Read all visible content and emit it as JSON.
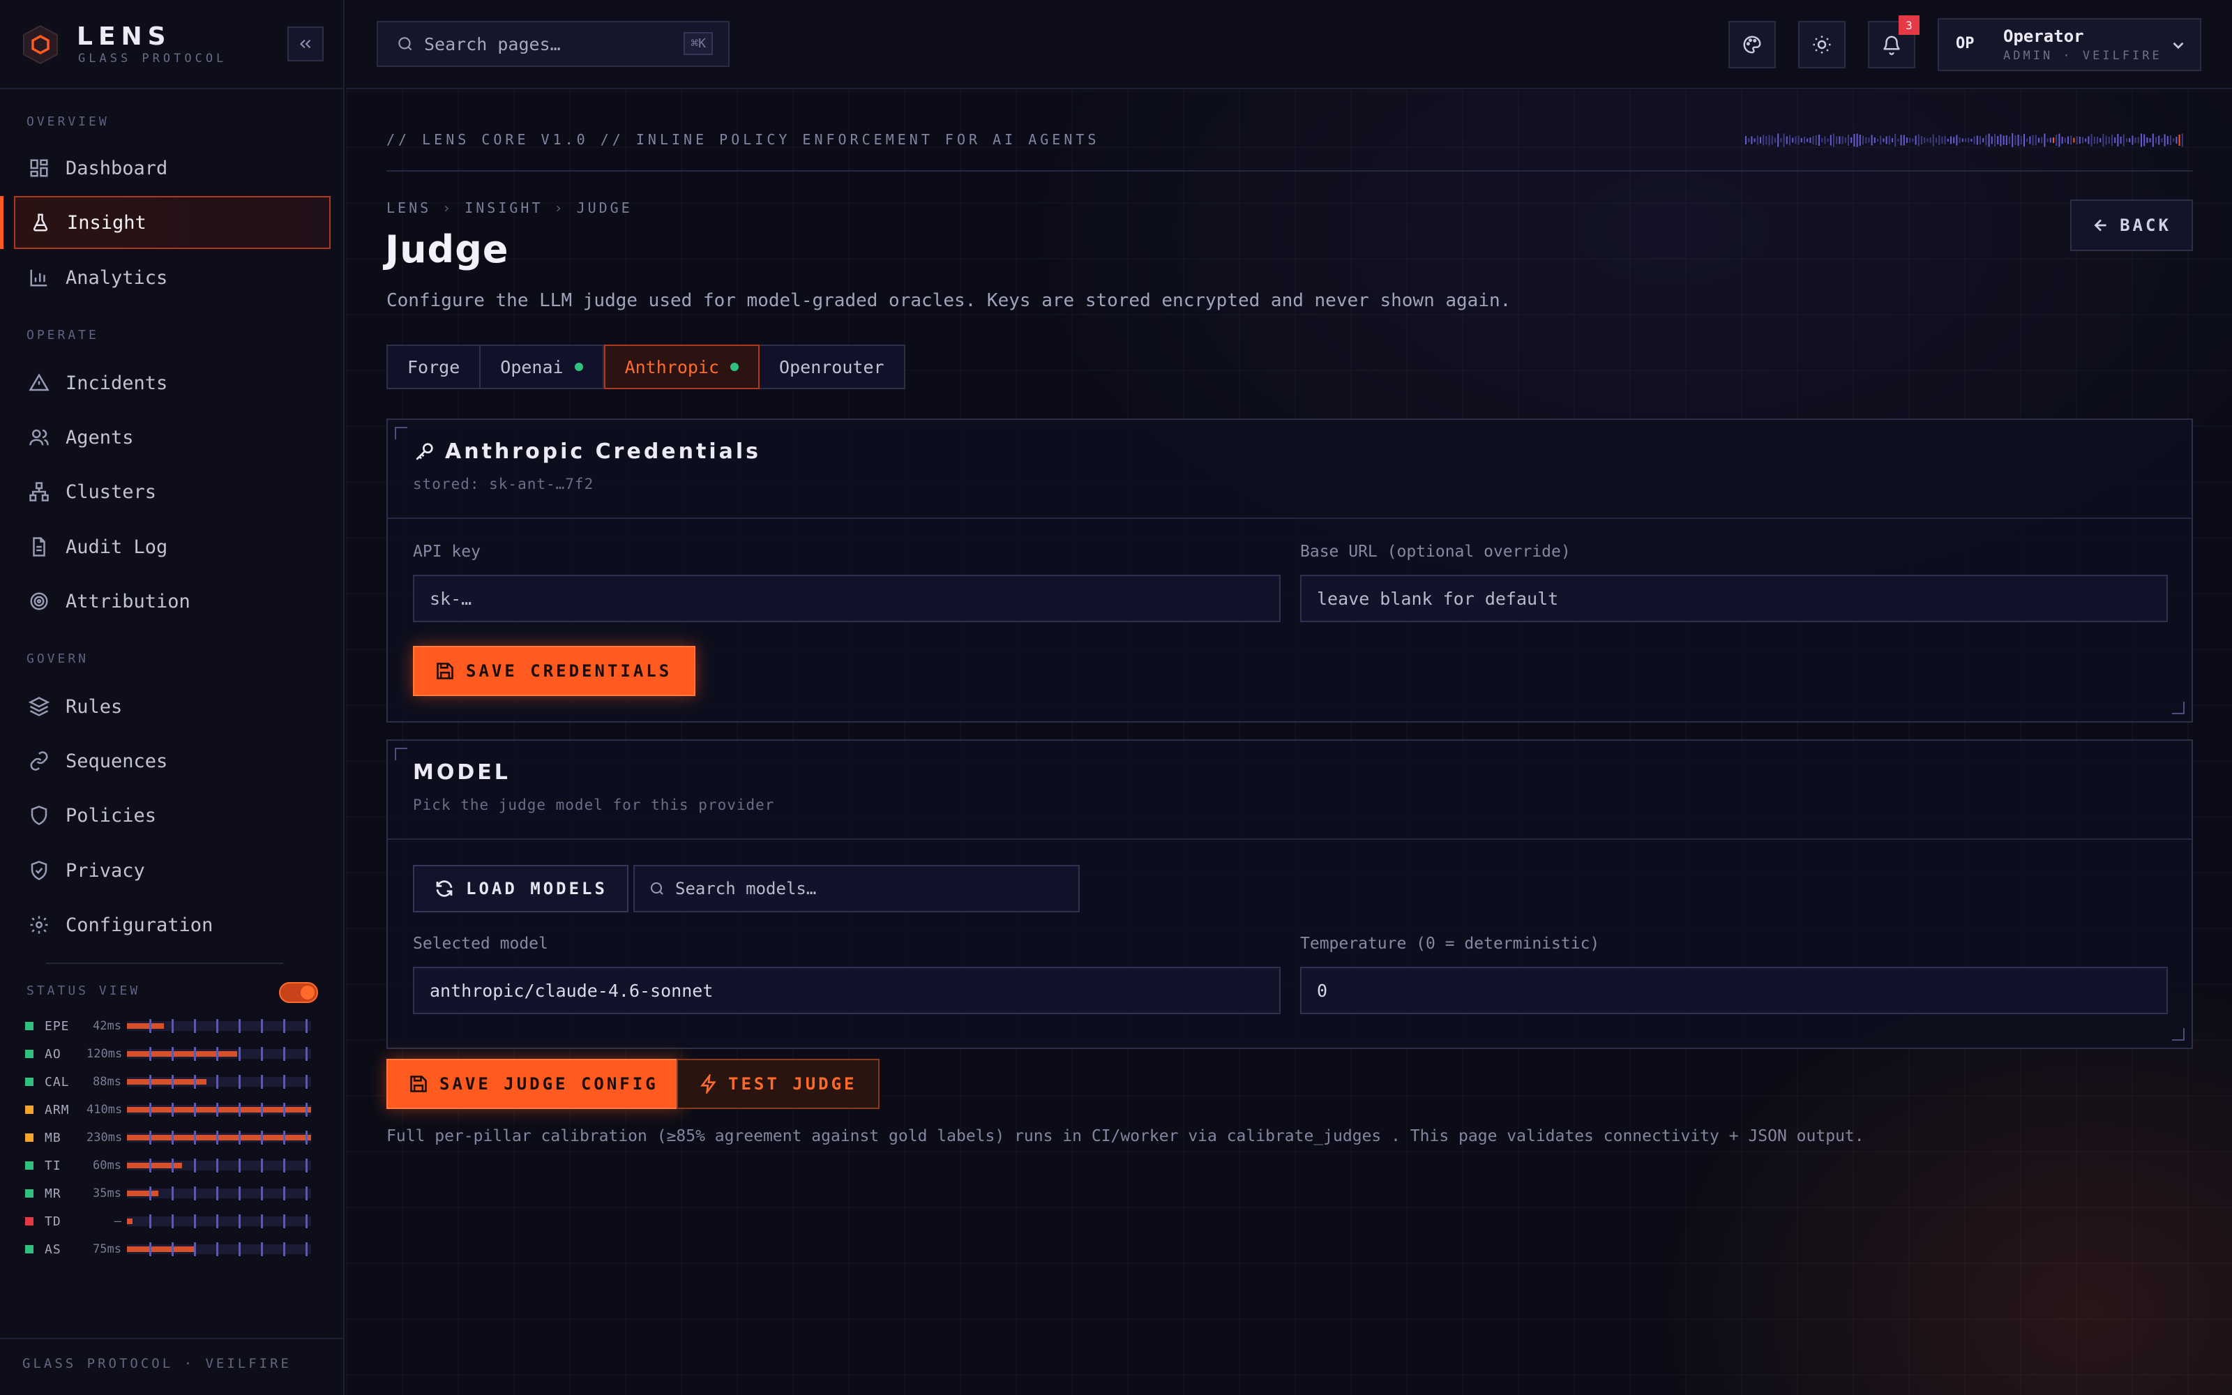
{
  "brand": {
    "name": "LENS",
    "subtitle": "GLASS PROTOCOL"
  },
  "sidebar": {
    "sections": [
      {
        "label": "OVERVIEW"
      },
      {
        "label": "OPERATE"
      },
      {
        "label": "GOVERN"
      }
    ],
    "items": [
      {
        "label": "Dashboard",
        "icon": "grid-icon"
      },
      {
        "label": "Insight",
        "icon": "flask-icon",
        "active": true
      },
      {
        "label": "Analytics",
        "icon": "bar-chart-icon"
      },
      {
        "label": "Incidents",
        "icon": "warning-icon"
      },
      {
        "label": "Agents",
        "icon": "users-icon"
      },
      {
        "label": "Clusters",
        "icon": "network-icon"
      },
      {
        "label": "Audit Log",
        "icon": "document-icon"
      },
      {
        "label": "Attribution",
        "icon": "target-icon"
      },
      {
        "label": "Rules",
        "icon": "layers-icon"
      },
      {
        "label": "Sequences",
        "icon": "link-icon"
      },
      {
        "label": "Policies",
        "icon": "shield-icon"
      },
      {
        "label": "Privacy",
        "icon": "shield-check-icon"
      },
      {
        "label": "Configuration",
        "icon": "gear-icon"
      }
    ],
    "status_view": {
      "title": "STATUS VIEW",
      "enabled": true,
      "rows": [
        {
          "code": "EPE",
          "ms": "42ms",
          "status": "ok",
          "level": 0.2
        },
        {
          "code": "AO",
          "ms": "120ms",
          "status": "ok",
          "level": 0.6
        },
        {
          "code": "CAL",
          "ms": "88ms",
          "status": "ok",
          "level": 0.43
        },
        {
          "code": "ARM",
          "ms": "410ms",
          "status": "warn",
          "level": 1.0
        },
        {
          "code": "MB",
          "ms": "230ms",
          "status": "warn",
          "level": 1.0
        },
        {
          "code": "TI",
          "ms": "60ms",
          "status": "ok",
          "level": 0.3
        },
        {
          "code": "MR",
          "ms": "35ms",
          "status": "ok",
          "level": 0.17
        },
        {
          "code": "TD",
          "ms": "—",
          "status": "error",
          "level": 0.03
        },
        {
          "code": "AS",
          "ms": "75ms",
          "status": "ok",
          "level": 0.37
        }
      ]
    },
    "footer": "GLASS PROTOCOL · VEILFIRE"
  },
  "colors": {
    "accent": "#ff5a1f",
    "ok": "#2ec27e",
    "warn": "#f4a52a",
    "error": "#e63946"
  },
  "topbar": {
    "search_placeholder": "Search pages…",
    "search_shortcut": "⌘K",
    "notifications_count": "3",
    "user": {
      "initials": "OP",
      "name": "Operator",
      "role": "ADMIN · VEILFIRE"
    }
  },
  "main": {
    "tagline": "// LENS CORE V1.0  //  INLINE POLICY ENFORCEMENT FOR AI AGENTS",
    "breadcrumb": [
      "LENS",
      "INSIGHT",
      "JUDGE"
    ],
    "back_label": "BACK",
    "title": "Judge",
    "description": "Configure the LLM judge used for model-graded oracles. Keys are stored encrypted and never shown again.",
    "tabs": [
      {
        "label": "Forge",
        "connected": false
      },
      {
        "label": "Openai",
        "connected": true
      },
      {
        "label": "Anthropic",
        "connected": true,
        "active": true
      },
      {
        "label": "Openrouter",
        "connected": false
      }
    ],
    "credentials": {
      "title": "Anthropic Credentials",
      "stored": "stored: sk-ant-…7f2",
      "api_key_label": "API key",
      "api_key_placeholder": "sk-…",
      "base_url_label": "Base URL (optional override)",
      "base_url_placeholder": "leave blank for default",
      "save_label": "SAVE CREDENTIALS"
    },
    "model": {
      "title": "MODEL",
      "subtitle": "Pick the judge model for this provider",
      "load_label": "LOAD MODELS",
      "search_placeholder": "Search models…",
      "selected_label": "Selected model",
      "selected_value": "anthropic/claude-4.6-sonnet",
      "temperature_label": "Temperature (0 = deterministic)",
      "temperature_value": "0"
    },
    "save_judge_label": "SAVE JUDGE CONFIG",
    "test_judge_label": "TEST JUDGE",
    "footnote": "Full per-pillar calibration (≥85% agreement against gold labels) runs in CI/worker via calibrate_judges . This page validates connectivity + JSON output."
  }
}
